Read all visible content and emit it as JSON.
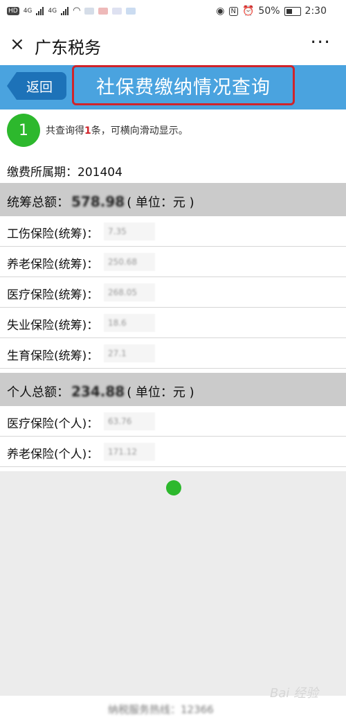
{
  "status_bar": {
    "hd": "HD",
    "signal1": "4G",
    "signal2": "4G",
    "battery_percent": "50%",
    "time": "2:30",
    "icons": [
      "eye-icon",
      "nfc-icon",
      "alarm-icon",
      "battery-icon"
    ]
  },
  "app_header": {
    "close_icon": "×",
    "title": "广东税务",
    "more_icon": "···"
  },
  "nav": {
    "back_label": "返回",
    "page_title": "社保费缴纳情况查询"
  },
  "step": {
    "number": "1",
    "text_before": "共查询得",
    "count": "1",
    "text_after": "条，可横向滑动显示。"
  },
  "period": {
    "label": "缴费所属期：",
    "value": "201404"
  },
  "pooled": {
    "label": "统筹总额：",
    "amount": "578.98",
    "unit": "( 单位：元 )",
    "items": [
      {
        "label": "工伤保险(统筹)：",
        "value": "7.35"
      },
      {
        "label": "养老保险(统筹)：",
        "value": "250.68"
      },
      {
        "label": "医疗保险(统筹)：",
        "value": "268.05"
      },
      {
        "label": "失业保险(统筹)：",
        "value": "18.6"
      },
      {
        "label": "生育保险(统筹)：",
        "value": "27.1"
      }
    ]
  },
  "personal": {
    "label": "个人总额：",
    "amount": "234.88",
    "unit": "( 单位：元 )",
    "items": [
      {
        "label": "医疗保险(个人)：",
        "value": "63.76"
      },
      {
        "label": "养老保险(个人)：",
        "value": "171.12"
      }
    ]
  },
  "footer": {
    "text": "纳税服务热线：12366"
  },
  "watermark": "Bai 经验",
  "colors": {
    "blue_bar": "#4aa3df",
    "back_button": "#1d72b8",
    "highlight_border": "#d0232a",
    "step_green": "#2db82d",
    "section_gray": "#cbcbcb"
  }
}
